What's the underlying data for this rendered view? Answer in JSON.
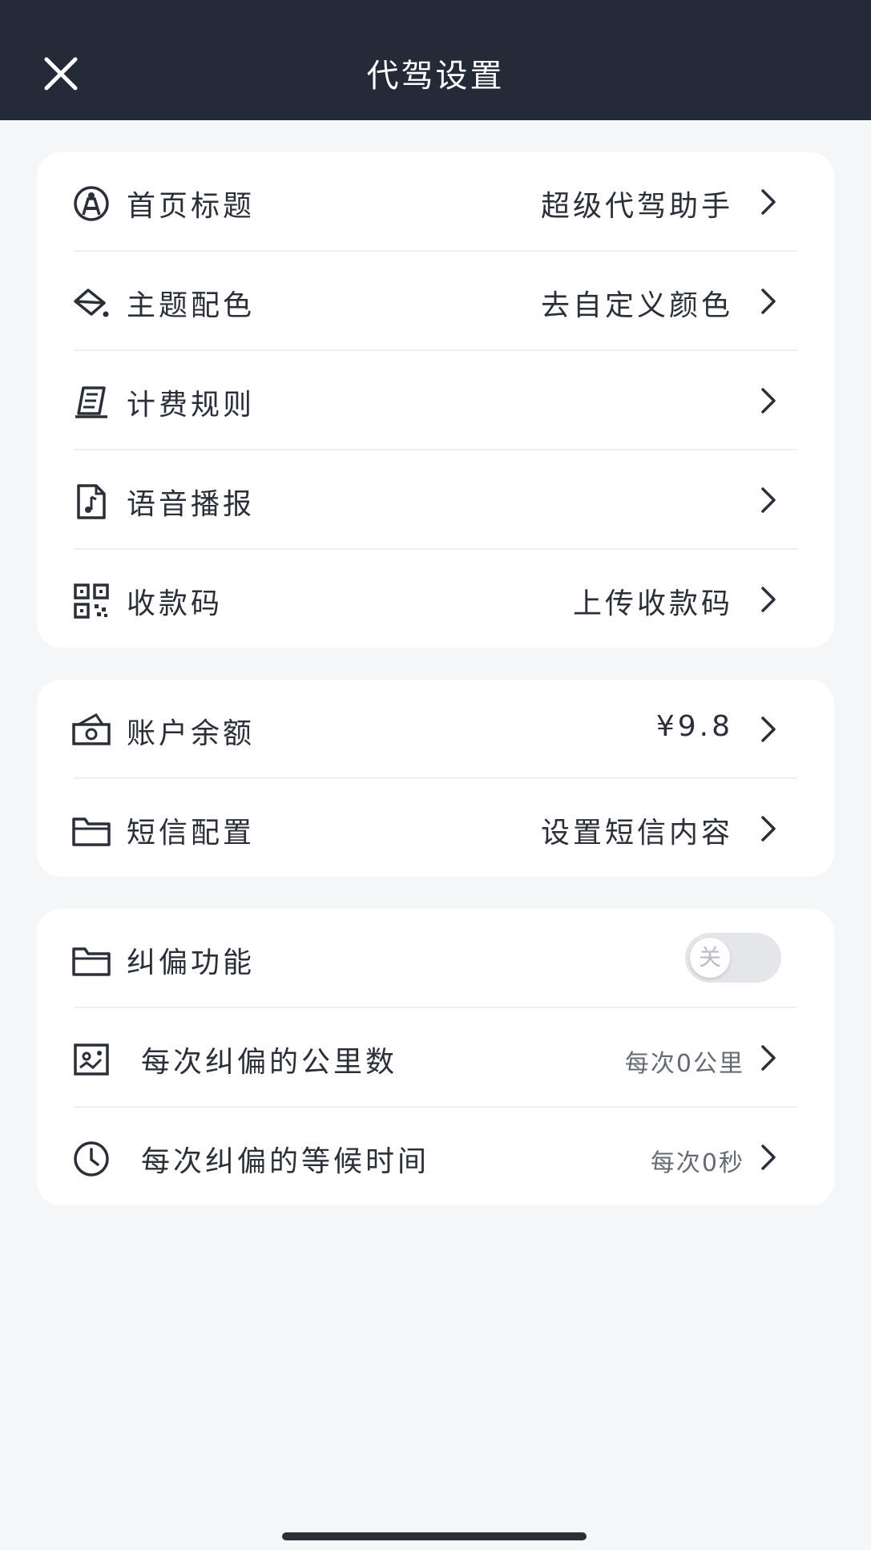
{
  "header": {
    "title": "代驾设置",
    "close_icon": "close-icon"
  },
  "card1": [
    {
      "icon": "driver-icon",
      "label": "首页标题",
      "value": "超级代驾助手"
    },
    {
      "icon": "paint-bucket-icon",
      "label": "主题配色",
      "value": "去自定义颜色"
    },
    {
      "icon": "billing-rules-icon",
      "label": "计费规则",
      "value": ""
    },
    {
      "icon": "audio-file-icon",
      "label": "语音播报",
      "value": ""
    },
    {
      "icon": "qr-code-icon",
      "label": "收款码",
      "value": "上传收款码"
    }
  ],
  "card2": [
    {
      "icon": "cash-icon",
      "label": "账户余额",
      "value": "¥9.8"
    },
    {
      "icon": "folder-icon",
      "label": "短信配置",
      "value": "设置短信内容"
    }
  ],
  "card3": {
    "toggle_row": {
      "icon": "folder-icon",
      "label": "纠偏功能",
      "toggle_text": "关",
      "toggle_on": false
    },
    "rows": [
      {
        "icon": "map-card-icon",
        "label": "每次纠偏的公里数",
        "value": "每次0公里"
      },
      {
        "icon": "clock-icon",
        "label": "每次纠偏的等候时间",
        "value": "每次0秒"
      }
    ]
  },
  "colors": {
    "header_bg": "#242a38",
    "page_bg": "#f5f6f8",
    "card_bg": "#ffffff",
    "text": "#2b2f37"
  }
}
